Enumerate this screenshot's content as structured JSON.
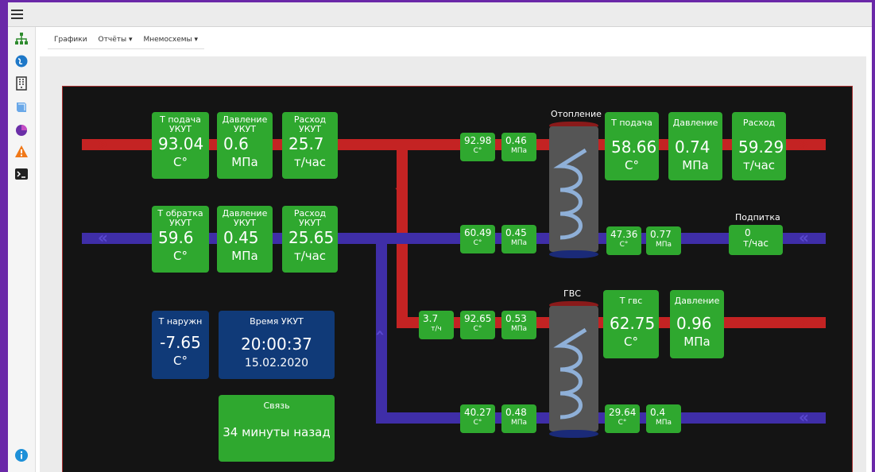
{
  "menu": {
    "items": [
      "Графики",
      "Отчёты ▾",
      "Мнемосхемы ▾"
    ]
  },
  "supply": {
    "t": {
      "label": "Т подача УКУТ",
      "value": "93.04",
      "unit": "С°"
    },
    "p": {
      "label": "Давление УКУТ",
      "value": "0.6",
      "unit": "МПа"
    },
    "f": {
      "label": "Расход УКУТ",
      "value": "25.7",
      "unit": "т/час"
    }
  },
  "return": {
    "t": {
      "label": "Т обратка УКУТ",
      "value": "59.6",
      "unit": "С°"
    },
    "p": {
      "label": "Давление УКУТ",
      "value": "0.45",
      "unit": "МПа"
    },
    "f": {
      "label": "Расход УКУТ",
      "value": "25.65",
      "unit": "т/час"
    }
  },
  "outdoor": {
    "label": "Т наружн",
    "value": "-7.65",
    "unit": "С°"
  },
  "time": {
    "label": "Время УКУТ",
    "time": "20:00:37",
    "date": "15.02.2020"
  },
  "link": {
    "label": "Связь",
    "value": "34 минуты назад"
  },
  "heating": {
    "title": "Отопление",
    "in_t": {
      "value": "92.98",
      "unit": "С°"
    },
    "in_p": {
      "value": "0.46",
      "unit": "МПа"
    },
    "ret_t": {
      "value": "60.49",
      "unit": "С°"
    },
    "ret_p": {
      "value": "0.45",
      "unit": "МПа"
    },
    "out_t": {
      "label": "Т подача",
      "value": "58.66",
      "unit": "С°"
    },
    "out_p": {
      "label": "Давление",
      "value": "0.74",
      "unit": "МПа"
    },
    "out_f": {
      "label": "Расход",
      "value": "59.29",
      "unit": "т/час"
    },
    "out_ret_t": {
      "value": "47.36",
      "unit": "С°"
    },
    "out_ret_p": {
      "value": "0.77",
      "unit": "МПа"
    },
    "makeup": {
      "title": "Подпитка",
      "value": "0",
      "unit": "т/час"
    }
  },
  "gvs": {
    "title": "ГВС",
    "flow": {
      "value": "3.7",
      "unit": "т/ч"
    },
    "in_t": {
      "value": "92.65",
      "unit": "С°"
    },
    "in_p": {
      "value": "0.53",
      "unit": "МПа"
    },
    "ret_t": {
      "value": "40.27",
      "unit": "С°"
    },
    "ret_p": {
      "value": "0.48",
      "unit": "МПа"
    },
    "out_t": {
      "label": "Т гвс",
      "value": "62.75",
      "unit": "С°"
    },
    "out_p": {
      "label": "Давление",
      "value": "0.96",
      "unit": "МПа"
    },
    "cw_t": {
      "value": "29.64",
      "unit": "С°"
    },
    "cw_p": {
      "value": "0.4",
      "unit": "МПа"
    }
  },
  "colors": {
    "supply": "#c42323",
    "return": "#3f2ea8",
    "sensor": "#2fa82f",
    "info": "#103a78"
  }
}
